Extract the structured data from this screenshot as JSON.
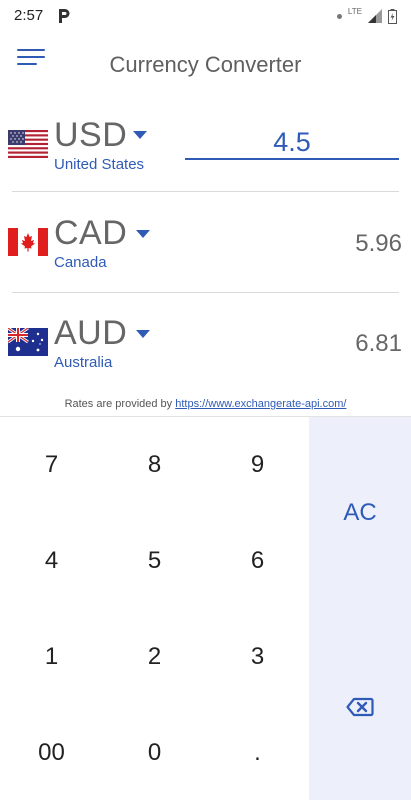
{
  "status_bar": {
    "time": "2:57",
    "network": "LTE",
    "notification_icon": "parking-icon"
  },
  "header": {
    "title": "Currency Converter",
    "menu_icon": "hamburger-menu-icon"
  },
  "currencies": [
    {
      "code": "USD",
      "country": "United States",
      "amount": "4.5",
      "flag_icon": "us-flag-icon",
      "is_input": true
    },
    {
      "code": "CAD",
      "country": "Canada",
      "amount": "5.96",
      "flag_icon": "canada-flag-icon",
      "is_input": false
    },
    {
      "code": "AUD",
      "country": "Australia",
      "amount": "6.81",
      "flag_icon": "australia-flag-icon",
      "is_input": false
    }
  ],
  "rates_note": {
    "prefix": "Rates are provided by ",
    "link_text": "https://www.exchangerate-api.com/"
  },
  "keypad": {
    "keys": [
      "7",
      "8",
      "9",
      "4",
      "5",
      "6",
      "1",
      "2",
      "3",
      "00",
      "0",
      "."
    ],
    "clear_label": "AC",
    "backspace_icon": "backspace-icon"
  },
  "colors": {
    "accent": "#2f5bb7",
    "side_panel": "#edf0fb",
    "text_gray": "#666666"
  }
}
